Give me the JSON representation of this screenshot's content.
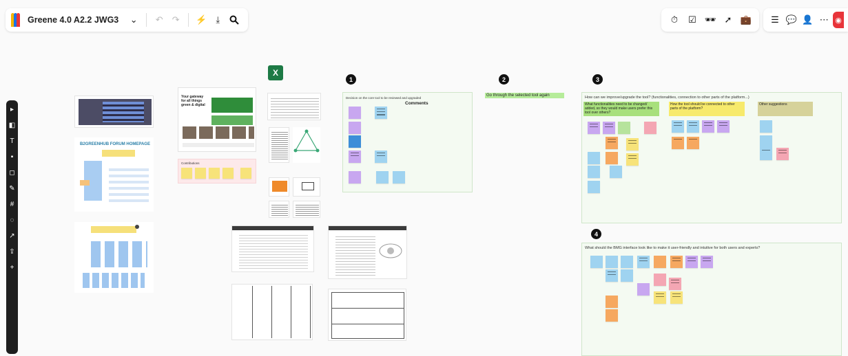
{
  "app": {
    "board_title": "Greene 4.0 A2.2 JWG3",
    "logo_colors": [
      "#f4b400",
      "#1a73e8",
      "#e8343a"
    ]
  },
  "toolbar_left": {
    "dropdown_icon": "chevron-down-icon",
    "undo_icon": "undo-icon",
    "redo_icon": "redo-icon",
    "lightning_icon": "lightning-icon",
    "export_icon": "download-icon",
    "search_icon": "search-icon"
  },
  "toolbar_right": {
    "timer_icon": "timer-icon",
    "vote_icon": "vote-icon",
    "incognito_icon": "incognito-icon",
    "pointer_icon": "cursor-sparkle-icon",
    "briefcase_icon": "briefcase-icon",
    "layout_icon": "layout-icon",
    "comment_icon": "comment-icon",
    "user_icon": "user-icon",
    "more_icon": "more-icon"
  },
  "canvas": {
    "forum_title": "B2GREENHUB FORUM HOMEPAGE",
    "green_heading": "Your gateway for all things green & digital",
    "contributions_label": "Contributions",
    "step1": {
      "number": "1",
      "subtitle": "Decision on the core tool to be reviewed and upgraded",
      "comments": "Comments",
      "notes": [
        "Open edX",
        "Circular Economy BM",
        "Go to MBO",
        "Open open source tool improve",
        "Pick tool",
        "In use?"
      ]
    },
    "step2": {
      "number": "2",
      "label": "Go through the selected tool again"
    },
    "step3": {
      "number": "3",
      "title": "How can we improve/upgrade the tool? (functionalities, connection to other parts of the platform...)",
      "col1": "What functionalities need to be changed/ added, so they would make users prefer this tool over others?",
      "col2": "How the tool should be connected to other parts of the platform?",
      "col3": "Other suggestions"
    },
    "step4": {
      "number": "4",
      "title": "What should the BMG interface look like to make it user-friendly and intuitive for both users and experts?"
    },
    "excel_label": "X"
  },
  "colors": {
    "accent_red": "#e8343a",
    "frame_green": "#f4faf2",
    "note_purple": "#c8a7f0",
    "note_blue": "#9fd3f0",
    "note_orange": "#f6a860",
    "note_yellow": "#f7e37a",
    "note_pink": "#f4a6b3",
    "note_green": "#b6e39c",
    "header_green": "#a8e07c",
    "header_yellow": "#f7ea6c",
    "header_olive": "#d6d29a"
  }
}
